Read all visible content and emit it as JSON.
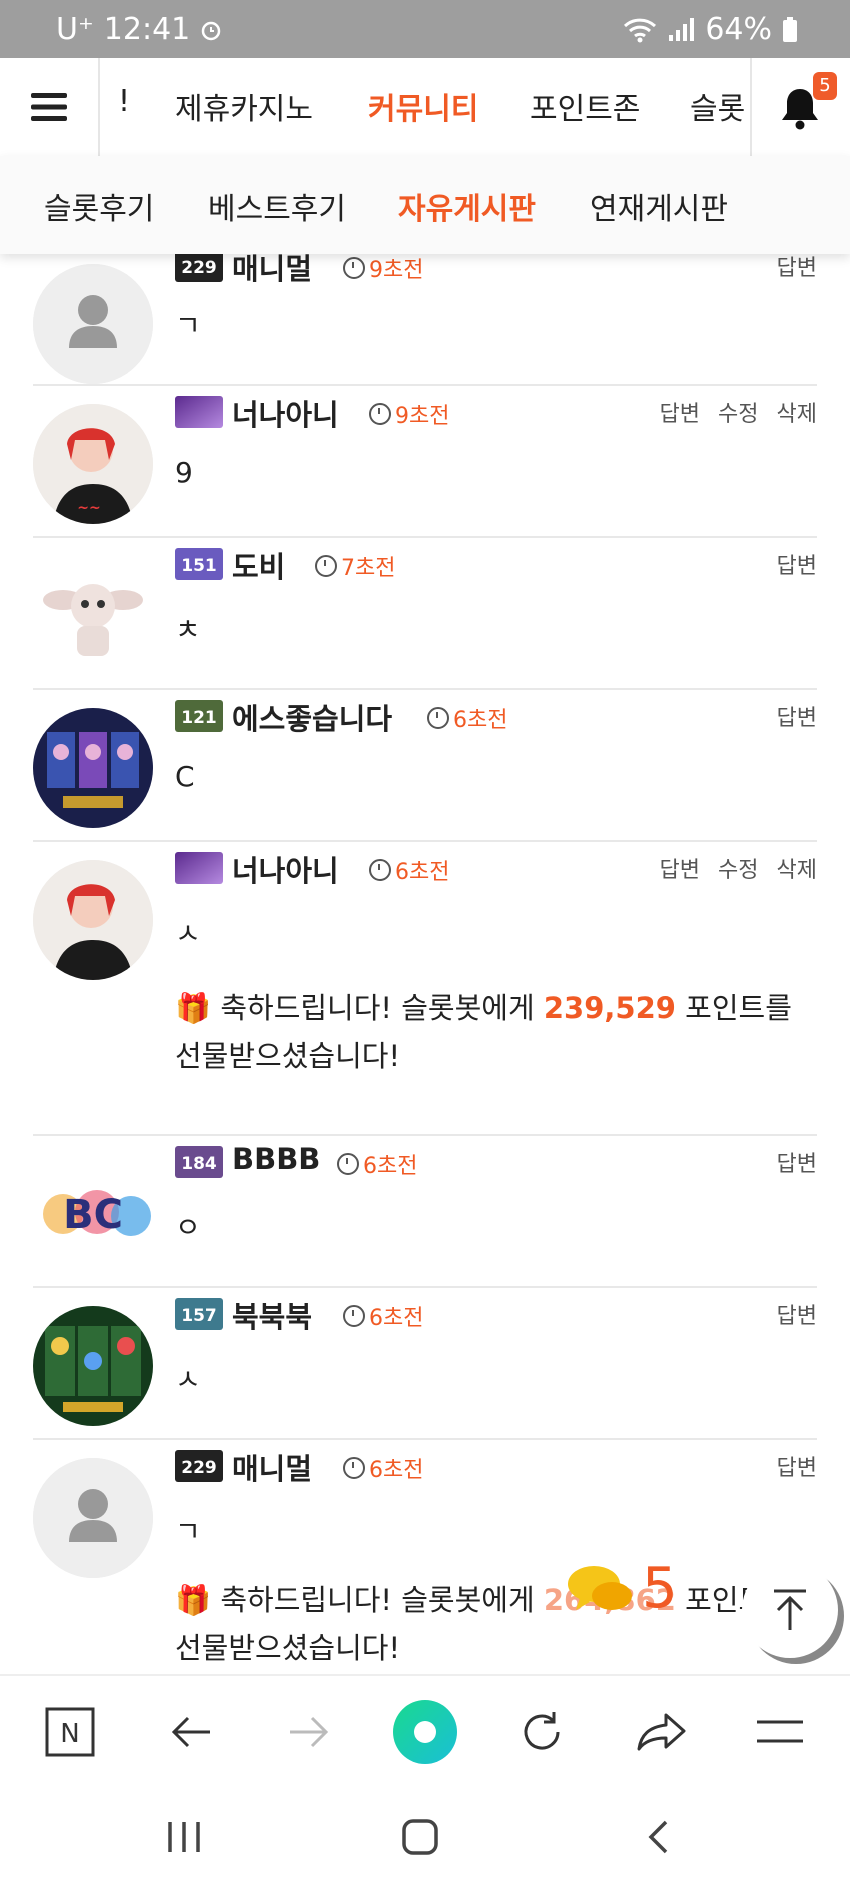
{
  "status_bar": {
    "carrier": "U⁺",
    "time": "12:41",
    "battery": "64%",
    "icons": [
      "alarm-icon",
      "wifi-icon",
      "signal-icon",
      "battery-icon"
    ]
  },
  "navbar": {
    "items": [
      "!",
      "제휴카지노",
      "커뮤니티",
      "포인트존",
      "슬롯"
    ],
    "active_index": 2,
    "notification_count": "5"
  },
  "subnav": {
    "items": [
      "슬롯후기",
      "베스트후기",
      "자유게시판",
      "연재게시판"
    ],
    "active_index": 2
  },
  "comments": [
    {
      "name": "매니멀",
      "time": "9초전",
      "body": "ㄱ",
      "actions": [
        "답변"
      ],
      "level_label": "229",
      "avatar": "default-user"
    },
    {
      "name": "너나아니",
      "time": "9초전",
      "body": "9",
      "actions": [
        "답변",
        "수정",
        "삭제"
      ],
      "level_label": "",
      "avatar": "photo-woman"
    },
    {
      "name": "도비",
      "time": "7초전",
      "body": "ㅊ",
      "actions": [
        "답변"
      ],
      "level_label": "151",
      "avatar": "dobby"
    },
    {
      "name": "에스좋습니다",
      "time": "6초전",
      "body": "C",
      "actions": [
        "답변"
      ],
      "level_label": "121",
      "avatar": "slot-game"
    },
    {
      "name": "너나아니",
      "time": "6초전",
      "body": "ㅅ",
      "actions": [
        "답변",
        "수정",
        "삭제"
      ],
      "level_label": "",
      "avatar": "photo-woman",
      "gift": {
        "prefix": "축하드립니다! 슬롯봇에게 ",
        "amount": "239,529",
        "suffix": " 포인트를 선물받으셨습니다!"
      }
    },
    {
      "name": "BBBB",
      "time": "6초전",
      "body": "ㅇ",
      "actions": [
        "답변"
      ],
      "level_label": "184",
      "avatar": "abc-letters"
    },
    {
      "name": "북북북",
      "time": "6초전",
      "body": "ㅅ",
      "actions": [
        "답변"
      ],
      "level_label": "157",
      "avatar": "slot-game-2"
    },
    {
      "name": "매니멀",
      "time": "6초전",
      "body": "ㄱ",
      "actions": [
        "답변"
      ],
      "level_label": "229",
      "avatar": "default-user",
      "gift": {
        "prefix": "축하드립니다! 슬롯봇에게 ",
        "amount": "264,862",
        "suffix": " 포인트를 선물받으셨습니다!"
      }
    }
  ],
  "floating": {
    "chat_count": "5"
  },
  "browser_bar": {
    "icons": [
      "naver-n-icon",
      "back-icon",
      "forward-icon",
      "home-circle-icon",
      "refresh-icon",
      "share-icon",
      "menu-icon"
    ]
  },
  "colors": {
    "accent": "#f05a24",
    "statusbar": "#9e9e9e",
    "home_circle": "#1fd3a6"
  }
}
